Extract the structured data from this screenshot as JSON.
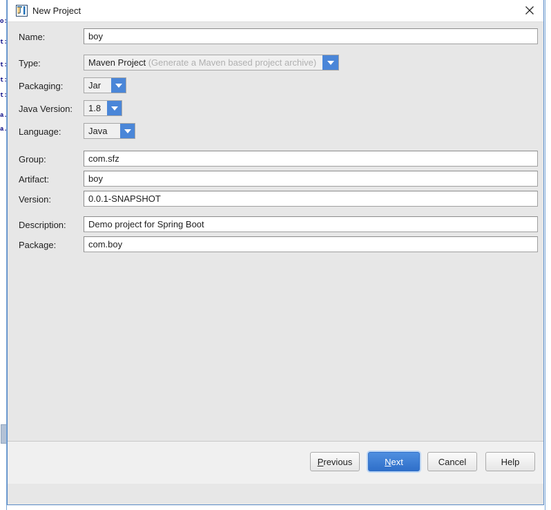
{
  "window": {
    "title": "New Project",
    "icon": "intellij-logo-icon",
    "close_label": "close-icon",
    "accent_blue": "#4a86d8",
    "primary_button_blue": "#2f6fc9",
    "dialog_background": "#e7e7e7",
    "field_background": "#ffffff"
  },
  "form": {
    "fields": [
      {
        "label": "Name:",
        "value": "boy",
        "kind": "text"
      },
      {
        "label": "Type:",
        "value": "Maven Project",
        "hint": "(Generate a Maven based project archive)",
        "kind": "combo"
      },
      {
        "label": "Packaging:",
        "value": "Jar",
        "kind": "combo"
      },
      {
        "label": "Java Version:",
        "value": "1.8",
        "kind": "combo"
      },
      {
        "label": "Language:",
        "value": "Java",
        "kind": "combo"
      },
      {
        "label": "Group:",
        "value": "com.sfz",
        "kind": "text"
      },
      {
        "label": "Artifact:",
        "value": "boy",
        "kind": "text"
      },
      {
        "label": "Version:",
        "value": "0.0.1-SNAPSHOT",
        "kind": "text"
      },
      {
        "label": "Description:",
        "value": "Demo project for Spring Boot",
        "kind": "text"
      },
      {
        "label": "Package:",
        "value": "com.boy",
        "kind": "text"
      }
    ]
  },
  "buttons": {
    "previous": {
      "label_pre": "",
      "mnemonic": "P",
      "label_post": "revious"
    },
    "next": {
      "label_pre": "",
      "mnemonic": "N",
      "label_post": "ext"
    },
    "cancel": {
      "label": "Cancel"
    },
    "help": {
      "label": "Help"
    }
  },
  "backdrop": {
    "code_fragments": [
      "o:",
      "t:",
      "t:",
      "t:",
      "t:",
      "a.",
      "a."
    ]
  }
}
